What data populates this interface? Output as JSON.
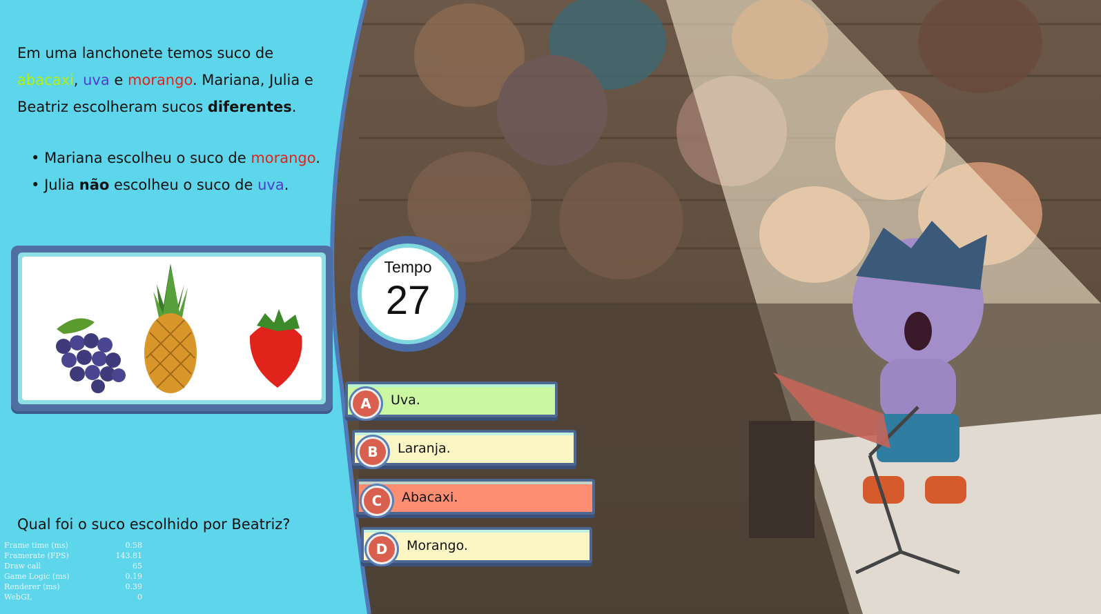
{
  "problem": {
    "intro_1": "Em uma lanchonete temos suco de",
    "fruit_a": "abacaxi",
    "sep_1": ", ",
    "fruit_b": "uva",
    "and": " e ",
    "fruit_c": "morango",
    "intro_2": ". Mariana, Julia e Beatriz escolheram sucos ",
    "intro_bold": "diferentes",
    "intro_end": ".",
    "clue_1_pre": "Mariana escolheu o suco de ",
    "clue_1_fruit": "morango",
    "clue_1_end": ".",
    "clue_2_pre": "Julia ",
    "clue_2_bold": "não",
    "clue_2_mid": " escolheu o suco de ",
    "clue_2_fruit": "uva",
    "clue_2_end": ".",
    "question": "Qual foi o suco escolhido por Beatriz?"
  },
  "fruits": [
    "grapes-image",
    "pineapple-image",
    "strawberry-image"
  ],
  "timer": {
    "label": "Tempo",
    "value": "27"
  },
  "answers": [
    {
      "letter": "A",
      "text": "Uva.",
      "color": "#ccf7a2"
    },
    {
      "letter": "B",
      "text": "Laranja.",
      "color": "#fbf6c3"
    },
    {
      "letter": "C",
      "text": "Abacaxi.",
      "color": "#fe8e72"
    },
    {
      "letter": "D",
      "text": "Morango.",
      "color": "#fbf6c3"
    }
  ],
  "debug": [
    {
      "label": "Frame time (ms)",
      "value": "0.58"
    },
    {
      "label": "Framerate (FPS)",
      "value": "143.81"
    },
    {
      "label": "Draw call",
      "value": "65"
    },
    {
      "label": "Game Logic (ms)",
      "value": "0.19"
    },
    {
      "label": "Renderer (ms)",
      "value": "0.39"
    },
    {
      "label": "WebGL",
      "value": "0"
    }
  ],
  "colors": {
    "panel": "#5dd5ea",
    "panel_edge": "#4f79b8"
  }
}
